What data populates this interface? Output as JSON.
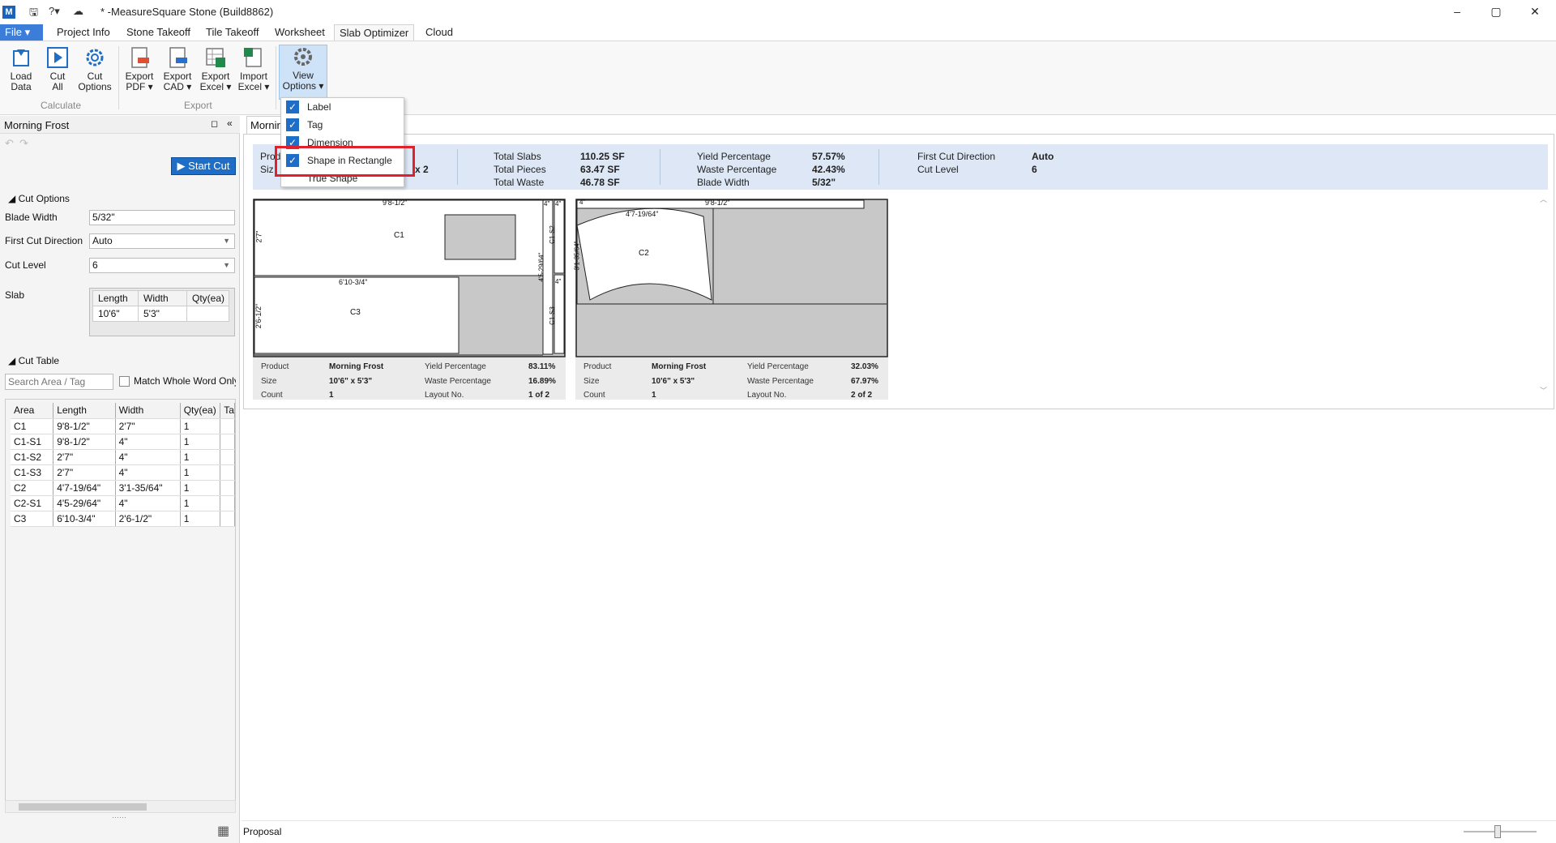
{
  "window": {
    "title": "* -MeasureSquare Stone (Build8862)",
    "controls": [
      "–",
      "▢",
      "✕"
    ]
  },
  "tabs": [
    "File",
    "Project Info",
    "Stone Takeoff",
    "Tile Takeoff",
    "Worksheet",
    "Slab Optimizer",
    "Cloud"
  ],
  "ribbon": {
    "load_data": "Load\nData",
    "cut_all": "Cut\nAll",
    "cut_options": "Cut\nOptions",
    "group_calculate": "Calculate",
    "export_pdf": "Export\nPDF ▾",
    "export_cad": "Export\nCAD ▾",
    "export_excel": "Export\nExcel ▾",
    "import_excel": "Import\nExcel ▾",
    "group_export": "Export",
    "view_options": "View\nOptions ▾"
  },
  "left_panel": {
    "title": "Morning Frost",
    "start_cut": "▶ Start Cut",
    "cut_options_header": "◢  Cut Options",
    "blade_width_label": "Blade Width",
    "blade_width_value": "5/32\"",
    "first_cut_label": "First Cut Direction",
    "first_cut_value": "Auto",
    "cut_level_label": "Cut Level",
    "cut_level_value": "6",
    "slab_label": "Slab",
    "slab_headers": [
      "Length",
      "Width",
      "Qty(ea)"
    ],
    "slab_row": [
      "10'6\"",
      "5'3\"",
      ""
    ],
    "cut_table_header": "◢  Cut Table",
    "search_placeholder": "Search Area / Tag",
    "match_label": "Match Whole Word Only",
    "cut_headers": [
      "Area",
      "Length",
      "Width",
      "Qty(ea)",
      "Ta"
    ],
    "cut_rows": [
      [
        "C1",
        "9'8-1/2\"",
        "2'7\"",
        "1"
      ],
      [
        "C1-S1",
        "9'8-1/2\"",
        "4\"",
        "1"
      ],
      [
        "C1-S2",
        "2'7\"",
        "4\"",
        "1"
      ],
      [
        "C1-S3",
        "2'7\"",
        "4\"",
        "1"
      ],
      [
        "C2",
        "4'7-19/64\"",
        "3'1-35/64\"",
        "1"
      ],
      [
        "C2-S1",
        "4'5-29/64\"",
        "4\"",
        "1"
      ],
      [
        "C3",
        "6'10-3/4\"",
        "2'6-1/2\"",
        "1"
      ]
    ]
  },
  "main": {
    "tab_label": "Mornir",
    "summary": {
      "product_label": "Prod",
      "size_label": "Siz",
      "size_tail": "x 2",
      "total_slabs_label": "Total Slabs",
      "total_slabs": "110.25 SF",
      "total_pieces_label": "Total Pieces",
      "total_pieces": "63.47 SF",
      "total_waste_label": "Total Waste",
      "total_waste": "46.78 SF",
      "yield_label": "Yield Percentage",
      "yield": "57.57%",
      "waste_label": "Waste Percentage",
      "waste": "42.43%",
      "blade_label": "Blade Width",
      "blade": "5/32\"",
      "first_cut_label": "First Cut Direction",
      "first_cut": "Auto",
      "cut_level_label": "Cut Level",
      "cut_level": "6"
    },
    "slabs": [
      {
        "piece_labels": {
          "c1_len": "9'8-1/2\"",
          "c1_w": "2'7\"",
          "c1": "C1",
          "c3_len": "6'10-3/4\"",
          "c3_w": "2'6-1/2\"",
          "c3": "C3",
          "s_a": "4\"",
          "s_b": "4\"",
          "s_c": "C1-S2",
          "s_d": "4'5-29/64\"",
          "s_e": "4\"",
          "s_f": "C1-S3"
        },
        "info": {
          "product_l": "Product",
          "product": "Morning Frost",
          "size_l": "Size",
          "size": "10'6\" x 5'3\"",
          "count_l": "Count",
          "count": "1",
          "yield_l": "Yield Percentage",
          "yield": "83.11%",
          "waste_l": "Waste Percentage",
          "waste": "16.89%",
          "layout_l": "Layout No.",
          "layout": "1 of 2"
        }
      },
      {
        "piece_labels": {
          "c2_len": "4'7-19/64\"",
          "c2": "C2",
          "c2_w": "3'1-35/64\"",
          "top_a": "4\"",
          "top_b": "9'8-1/2\""
        },
        "info": {
          "product_l": "Product",
          "product": "Morning Frost",
          "size_l": "Size",
          "size": "10'6\" x 5'3\"",
          "count_l": "Count",
          "count": "1",
          "yield_l": "Yield Percentage",
          "yield": "32.03%",
          "waste_l": "Waste Percentage",
          "waste": "67.97%",
          "layout_l": "Layout No.",
          "layout": "2 of 2"
        }
      }
    ]
  },
  "view_menu": {
    "items": [
      {
        "label": "Label",
        "checked": true
      },
      {
        "label": "Tag",
        "checked": true
      },
      {
        "label": "Dimension",
        "checked": true
      },
      {
        "label": "Shape in Rectangle",
        "checked": true
      },
      {
        "label": "True Shape",
        "checked": false
      }
    ]
  },
  "status": {
    "text": "Proposal"
  },
  "colors": {
    "accent": "#1e6ec8",
    "highlight": "#e0212b",
    "summary_bg": "#dde7f5",
    "waste_gray": "#c8c8c8"
  }
}
